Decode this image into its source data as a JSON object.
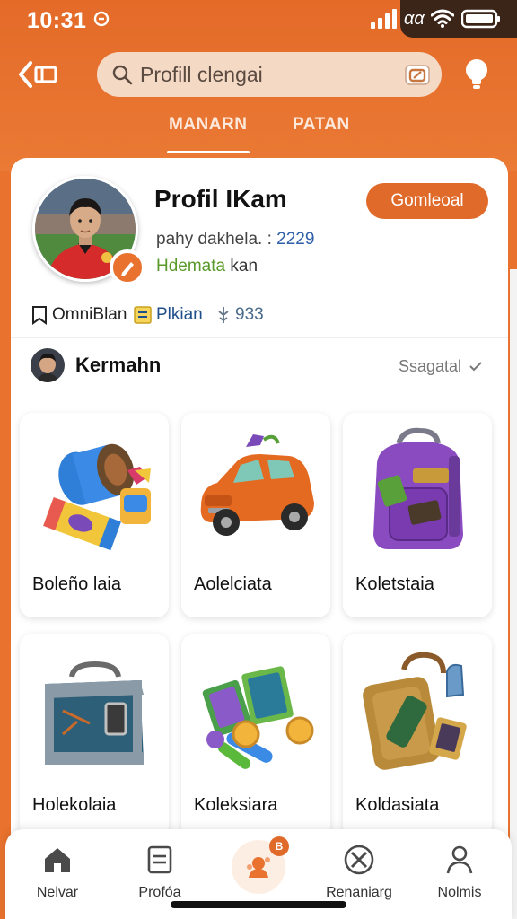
{
  "status_bar": {
    "time": "10:31",
    "carrier": "αα"
  },
  "header": {
    "search_placeholder": "Profill clengai",
    "tabs": [
      {
        "label": "MANARN",
        "active": true
      },
      {
        "label": "PATAN",
        "active": false
      }
    ]
  },
  "profile": {
    "name": "Profil IKam",
    "meta_text": "pahy dakhela. :",
    "meta_number": "2229",
    "status_highlight": "Hdemata",
    "status_rest": "kan",
    "follow_label": "Gomleoal",
    "stats": [
      {
        "icon": "bookmark-icon",
        "label": "OmniBlan"
      },
      {
        "icon": "note-icon",
        "label": "Plkian"
      },
      {
        "icon": "coin-icon",
        "label": "933"
      }
    ]
  },
  "section": {
    "title": "Kermahn",
    "filter_label": "Ssagatal"
  },
  "collection": [
    {
      "label": "Boleño laia",
      "art": "yo-yo-gears"
    },
    {
      "label": "Aolelciata",
      "art": "orange-car"
    },
    {
      "label": "Koletstaia",
      "art": "purple-backpack"
    },
    {
      "label": "Holekolaia",
      "art": "steel-chest"
    },
    {
      "label": "Koleksiara",
      "art": "cards-and-wands"
    },
    {
      "label": "Koldasiata",
      "art": "golden-lantern"
    }
  ],
  "bottom_nav": {
    "items": [
      {
        "label": "Nelvar",
        "icon": "home-icon"
      },
      {
        "label": "Profóa",
        "icon": "list-icon"
      },
      {
        "label": "Renaniarg",
        "icon": "tools-icon"
      },
      {
        "label": "Nolmis",
        "icon": "user-icon"
      }
    ],
    "center_badge": "B"
  },
  "colors": {
    "accent": "#e8722e",
    "button": "#e06a2a",
    "link": "#2f5fa8",
    "status_green": "#5a9a2a"
  }
}
